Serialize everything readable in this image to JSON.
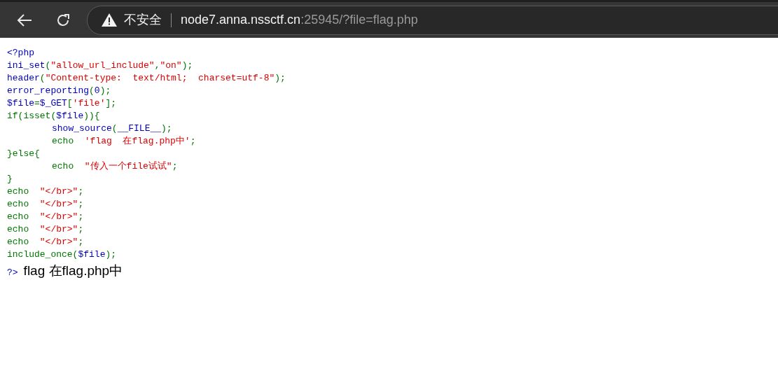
{
  "browser": {
    "security_label": "不安全",
    "url_host": "node7.anna.nssctf.cn",
    "url_rest": ":25945/?file=flag.php"
  },
  "code_lines": [
    {
      "tokens": [
        {
          "kind": "default",
          "text": "<?php"
        }
      ]
    },
    {
      "tokens": [
        {
          "kind": "default",
          "text": "ini_set"
        },
        {
          "kind": "keyword",
          "text": "("
        },
        {
          "kind": "string",
          "text": "\"allow_url_include\""
        },
        {
          "kind": "keyword",
          "text": ","
        },
        {
          "kind": "string",
          "text": "\"on\""
        },
        {
          "kind": "keyword",
          "text": ");"
        }
      ]
    },
    {
      "tokens": [
        {
          "kind": "default",
          "text": "header"
        },
        {
          "kind": "keyword",
          "text": "("
        },
        {
          "kind": "string",
          "text": "\"Content-type:  text/html;  charset=utf-8\""
        },
        {
          "kind": "keyword",
          "text": ");"
        }
      ]
    },
    {
      "tokens": [
        {
          "kind": "default",
          "text": "error_reporting"
        },
        {
          "kind": "keyword",
          "text": "("
        },
        {
          "kind": "default",
          "text": "0"
        },
        {
          "kind": "keyword",
          "text": ");"
        }
      ]
    },
    {
      "tokens": [
        {
          "kind": "default",
          "text": "$file"
        },
        {
          "kind": "keyword",
          "text": "="
        },
        {
          "kind": "default",
          "text": "$_GET"
        },
        {
          "kind": "keyword",
          "text": "["
        },
        {
          "kind": "string",
          "text": "'file'"
        },
        {
          "kind": "keyword",
          "text": "];"
        }
      ]
    },
    {
      "tokens": [
        {
          "kind": "keyword",
          "text": "if(isset("
        },
        {
          "kind": "default",
          "text": "$file"
        },
        {
          "kind": "keyword",
          "text": ")){"
        }
      ],
      "children": [
        {
          "tokens": [
            {
              "kind": "default",
              "text": "show_source"
            },
            {
              "kind": "keyword",
              "text": "("
            },
            {
              "kind": "default",
              "text": "__FILE__"
            },
            {
              "kind": "keyword",
              "text": ");"
            }
          ]
        },
        {
          "tokens": [
            {
              "kind": "keyword",
              "text": "echo  "
            },
            {
              "kind": "string",
              "text": "'flag  在flag.php中'"
            },
            {
              "kind": "keyword",
              "text": ";"
            }
          ]
        }
      ]
    },
    {
      "tokens": [
        {
          "kind": "keyword",
          "text": "}else{"
        }
      ],
      "children": [
        {
          "tokens": [
            {
              "kind": "keyword",
              "text": "echo  "
            },
            {
              "kind": "string",
              "text": "\"传入一个file试试\""
            },
            {
              "kind": "keyword",
              "text": ";"
            }
          ]
        }
      ]
    },
    {
      "tokens": [
        {
          "kind": "keyword",
          "text": "}"
        }
      ]
    },
    {
      "tokens": [
        {
          "kind": "keyword",
          "text": "echo  "
        },
        {
          "kind": "string",
          "text": "\"</br>\""
        },
        {
          "kind": "keyword",
          "text": ";"
        }
      ]
    },
    {
      "tokens": [
        {
          "kind": "keyword",
          "text": "echo  "
        },
        {
          "kind": "string",
          "text": "\"</br>\""
        },
        {
          "kind": "keyword",
          "text": ";"
        }
      ]
    },
    {
      "tokens": [
        {
          "kind": "keyword",
          "text": "echo  "
        },
        {
          "kind": "string",
          "text": "\"</br>\""
        },
        {
          "kind": "keyword",
          "text": ";"
        }
      ]
    },
    {
      "tokens": [
        {
          "kind": "keyword",
          "text": "echo  "
        },
        {
          "kind": "string",
          "text": "\"</br>\""
        },
        {
          "kind": "keyword",
          "text": ";"
        }
      ]
    },
    {
      "tokens": [
        {
          "kind": "keyword",
          "text": "echo  "
        },
        {
          "kind": "string",
          "text": "\"</br>\""
        },
        {
          "kind": "keyword",
          "text": ";"
        }
      ]
    },
    {
      "tokens": [
        {
          "kind": "keyword",
          "text": "include_once("
        },
        {
          "kind": "default",
          "text": "$file"
        },
        {
          "kind": "keyword",
          "text": ");"
        }
      ]
    }
  ],
  "output": {
    "end_tag": "?>",
    "text": "flag 在flag.php中"
  }
}
